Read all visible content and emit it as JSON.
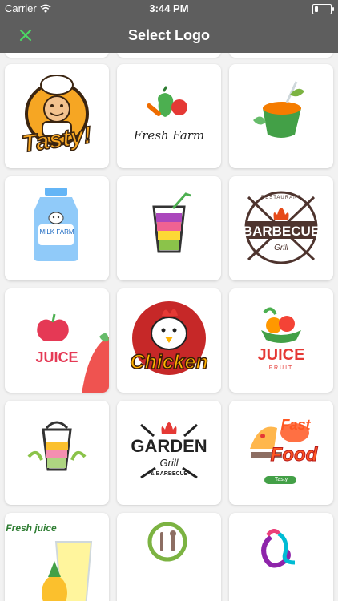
{
  "status": {
    "carrier": "Carrier",
    "time": "3:44 PM"
  },
  "nav": {
    "title": "Select Logo",
    "close_icon": "close-x-icon"
  },
  "colors": {
    "bar": "#5e5e5e",
    "accent": "#4cd964",
    "background": "#f2f2f2"
  },
  "logos": {
    "tasty": "Tasty!",
    "fresh_farm": "Fresh Farm",
    "milk_farm": "MILK FARM",
    "barbecue": "BARBECUE",
    "barbecue_top": "RESTAURANT",
    "barbecue_bottom": "Grill",
    "juice": "JUICE",
    "chicken": "Chicken",
    "juice_fruit": "JUICE",
    "juice_fruit_sub": "FRUIT",
    "garden": "GARDEN",
    "garden_grill": "Grill",
    "garden_bbq": "& BARBECUE",
    "fast_food_1": "Fast",
    "fast_food_2": "Food",
    "fast_food_sub": "Tasty",
    "fresh_juice": "Fresh juice"
  }
}
